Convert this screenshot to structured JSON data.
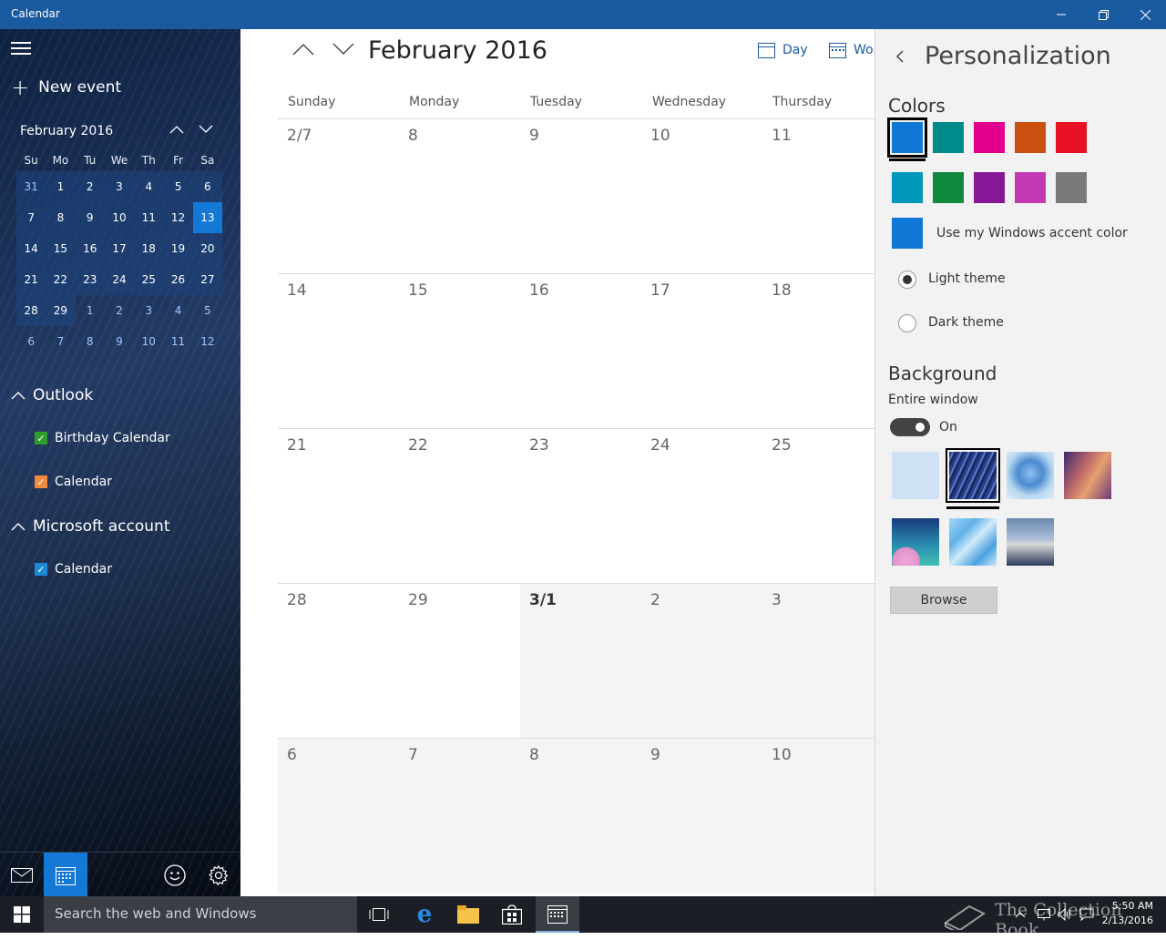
{
  "window": {
    "title": "Calendar"
  },
  "sidebar": {
    "new_event": "New event",
    "mini_calendar": {
      "month_label": "February 2016",
      "weekdays": [
        "Su",
        "Mo",
        "Tu",
        "We",
        "Th",
        "Fr",
        "Sa"
      ],
      "weeks": [
        [
          "31",
          "1",
          "2",
          "3",
          "4",
          "5",
          "6"
        ],
        [
          "7",
          "8",
          "9",
          "10",
          "11",
          "12",
          "13"
        ],
        [
          "14",
          "15",
          "16",
          "17",
          "18",
          "19",
          "20"
        ],
        [
          "21",
          "22",
          "23",
          "24",
          "25",
          "26",
          "27"
        ],
        [
          "28",
          "29",
          "1",
          "2",
          "3",
          "4",
          "5"
        ],
        [
          "6",
          "7",
          "8",
          "9",
          "10",
          "11",
          "12"
        ]
      ],
      "today": "13"
    },
    "sections": [
      {
        "label": "Outlook",
        "calendars": [
          {
            "label": "Birthday Calendar",
            "color": "#2e9e2e"
          },
          {
            "label": "Calendar",
            "color": "#f08a3c"
          }
        ]
      },
      {
        "label": "Microsoft account",
        "calendars": [
          {
            "label": "Calendar",
            "color": "#1a8ad4"
          }
        ]
      }
    ]
  },
  "main": {
    "title": "February 2016",
    "views": {
      "day": "Day",
      "work_week": "Wor"
    },
    "day_headers": [
      "Sunday",
      "Monday",
      "Tuesday",
      "Wednesday",
      "Thursday"
    ],
    "weeks": [
      [
        "2/7",
        "8",
        "9",
        "10",
        "11"
      ],
      [
        "14",
        "15",
        "16",
        "17",
        "18"
      ],
      [
        "21",
        "22",
        "23",
        "24",
        "25"
      ],
      [
        "28",
        "29",
        "3/1",
        "2",
        "3"
      ],
      [
        "6",
        "7",
        "8",
        "9",
        "10"
      ]
    ]
  },
  "personalization": {
    "title": "Personalization",
    "colors_heading": "Colors",
    "colors_row1": [
      "#0f78d7",
      "#008b8b",
      "#e3008c",
      "#ca5010",
      "#e81123"
    ],
    "colors_row2": [
      "#0099bc",
      "#10893e",
      "#881798",
      "#c239b3",
      "#7a7a7a"
    ],
    "accent_color": "#0f78d7",
    "accent_label": "Use my Windows accent color",
    "light_theme": "Light theme",
    "dark_theme": "Dark theme",
    "background_heading": "Background",
    "entire_window": "Entire window",
    "toggle_state": "On",
    "browse": "Browse"
  },
  "taskbar": {
    "search_placeholder": "Search the web and Windows",
    "time": "5:50 AM",
    "date": "2/13/2016",
    "watermark": "The Collection Book"
  }
}
